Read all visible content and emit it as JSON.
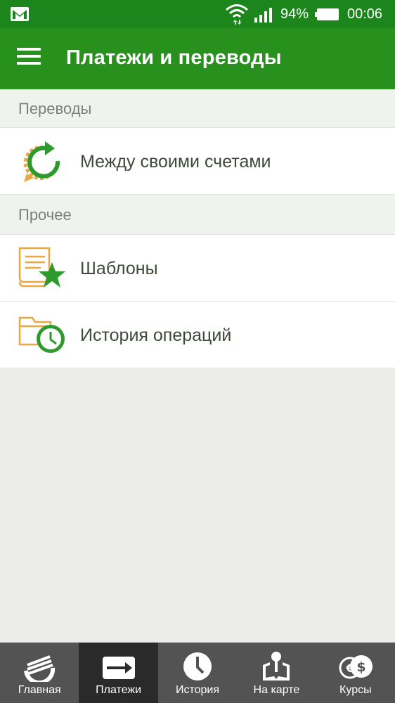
{
  "status": {
    "battery": "94%",
    "time": "00:06"
  },
  "appbar": {
    "title": "Платежи и переводы"
  },
  "sections": [
    {
      "header": "Переводы",
      "items": [
        {
          "label": "Между своими счетами",
          "icon": "transfer-arrows-icon"
        }
      ]
    },
    {
      "header": "Прочее",
      "items": [
        {
          "label": "Шаблоны",
          "icon": "template-star-icon"
        },
        {
          "label": "История операций",
          "icon": "history-clock-icon"
        }
      ]
    }
  ],
  "bottom_nav": [
    {
      "label": "Главная",
      "icon": "sberbank-logo-icon"
    },
    {
      "label": "Платежи",
      "icon": "payments-arrow-icon",
      "active": true
    },
    {
      "label": "История",
      "icon": "clock-icon"
    },
    {
      "label": "На карте",
      "icon": "map-pin-icon"
    },
    {
      "label": "Курсы",
      "icon": "currency-icon"
    }
  ],
  "colors": {
    "statusbar": "#1c861c",
    "appbar": "#28911e",
    "accent_orange": "#e9a840",
    "accent_green": "#2e9a2e"
  }
}
